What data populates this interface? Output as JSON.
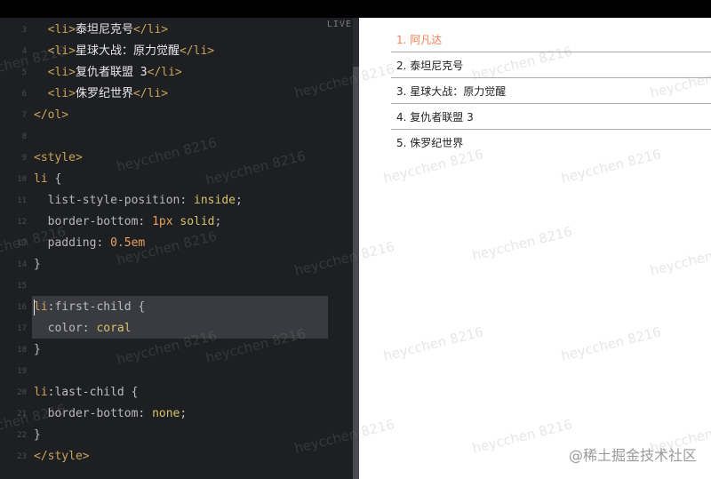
{
  "editor": {
    "live_label": "LIVE",
    "lines": [
      {
        "n": "3",
        "tokens": [
          [
            "tag",
            "  <li>"
          ],
          [
            "inner",
            "泰坦尼克号"
          ],
          [
            "tag",
            "</li>"
          ]
        ]
      },
      {
        "n": "4",
        "tokens": [
          [
            "tag",
            "  <li>"
          ],
          [
            "inner",
            "星球大战：原力觉醒"
          ],
          [
            "tag",
            "</li>"
          ]
        ]
      },
      {
        "n": "5",
        "tokens": [
          [
            "tag",
            "  <li>"
          ],
          [
            "inner",
            "复仇者联盟 3"
          ],
          [
            "tag",
            "</li>"
          ]
        ]
      },
      {
        "n": "6",
        "tokens": [
          [
            "tag",
            "  <li>"
          ],
          [
            "inner",
            "侏罗纪世界"
          ],
          [
            "tag",
            "</li>"
          ]
        ]
      },
      {
        "n": "7",
        "tokens": [
          [
            "tag",
            "</ol>"
          ]
        ]
      },
      {
        "n": "8",
        "tokens": []
      },
      {
        "n": "9",
        "tokens": [
          [
            "tag",
            "<style>"
          ]
        ]
      },
      {
        "n": "10",
        "tokens": [
          [
            "sel",
            "li"
          ],
          [
            "punc",
            " {"
          ]
        ]
      },
      {
        "n": "11",
        "tokens": [
          [
            "prop",
            "  list-style-position"
          ],
          [
            "punc",
            ": "
          ],
          [
            "val",
            "inside"
          ],
          [
            "punc",
            ";"
          ]
        ]
      },
      {
        "n": "12",
        "tokens": [
          [
            "prop",
            "  border-bottom"
          ],
          [
            "punc",
            ": "
          ],
          [
            "num",
            "1px"
          ],
          [
            "val",
            " solid"
          ],
          [
            "punc",
            ";"
          ]
        ]
      },
      {
        "n": "13",
        "tokens": [
          [
            "prop",
            "  padding"
          ],
          [
            "punc",
            ": "
          ],
          [
            "num",
            "0.5em"
          ]
        ]
      },
      {
        "n": "14",
        "tokens": [
          [
            "punc",
            "}"
          ]
        ]
      },
      {
        "n": "15",
        "tokens": []
      },
      {
        "n": "16",
        "tokens": [
          [
            "sel",
            "li"
          ],
          [
            "punc",
            ":first-child {"
          ]
        ]
      },
      {
        "n": "17",
        "tokens": [
          [
            "prop",
            "  color"
          ],
          [
            "punc",
            ": "
          ],
          [
            "val",
            "coral"
          ]
        ]
      },
      {
        "n": "18",
        "tokens": [
          [
            "punc",
            "}"
          ]
        ]
      },
      {
        "n": "19",
        "tokens": []
      },
      {
        "n": "20",
        "tokens": [
          [
            "sel",
            "li"
          ],
          [
            "punc",
            ":last-child {"
          ]
        ]
      },
      {
        "n": "21",
        "tokens": [
          [
            "prop",
            "  border-bottom"
          ],
          [
            "punc",
            ": "
          ],
          [
            "val",
            "none"
          ],
          [
            "punc",
            ";"
          ]
        ]
      },
      {
        "n": "22",
        "tokens": [
          [
            "punc",
            "}"
          ]
        ]
      },
      {
        "n": "23",
        "tokens": [
          [
            "tag",
            "</style>"
          ]
        ]
      }
    ]
  },
  "preview": {
    "items": [
      "1. 阿凡达",
      "2. 泰坦尼克号",
      "3. 星球大战：原力觉醒",
      "4. 复仇者联盟 3",
      "5. 侏罗纪世界"
    ],
    "first_child_color": "#ff7f50"
  },
  "watermark_text": "heycchen 8216",
  "brand": "@稀土掘金技术社区"
}
